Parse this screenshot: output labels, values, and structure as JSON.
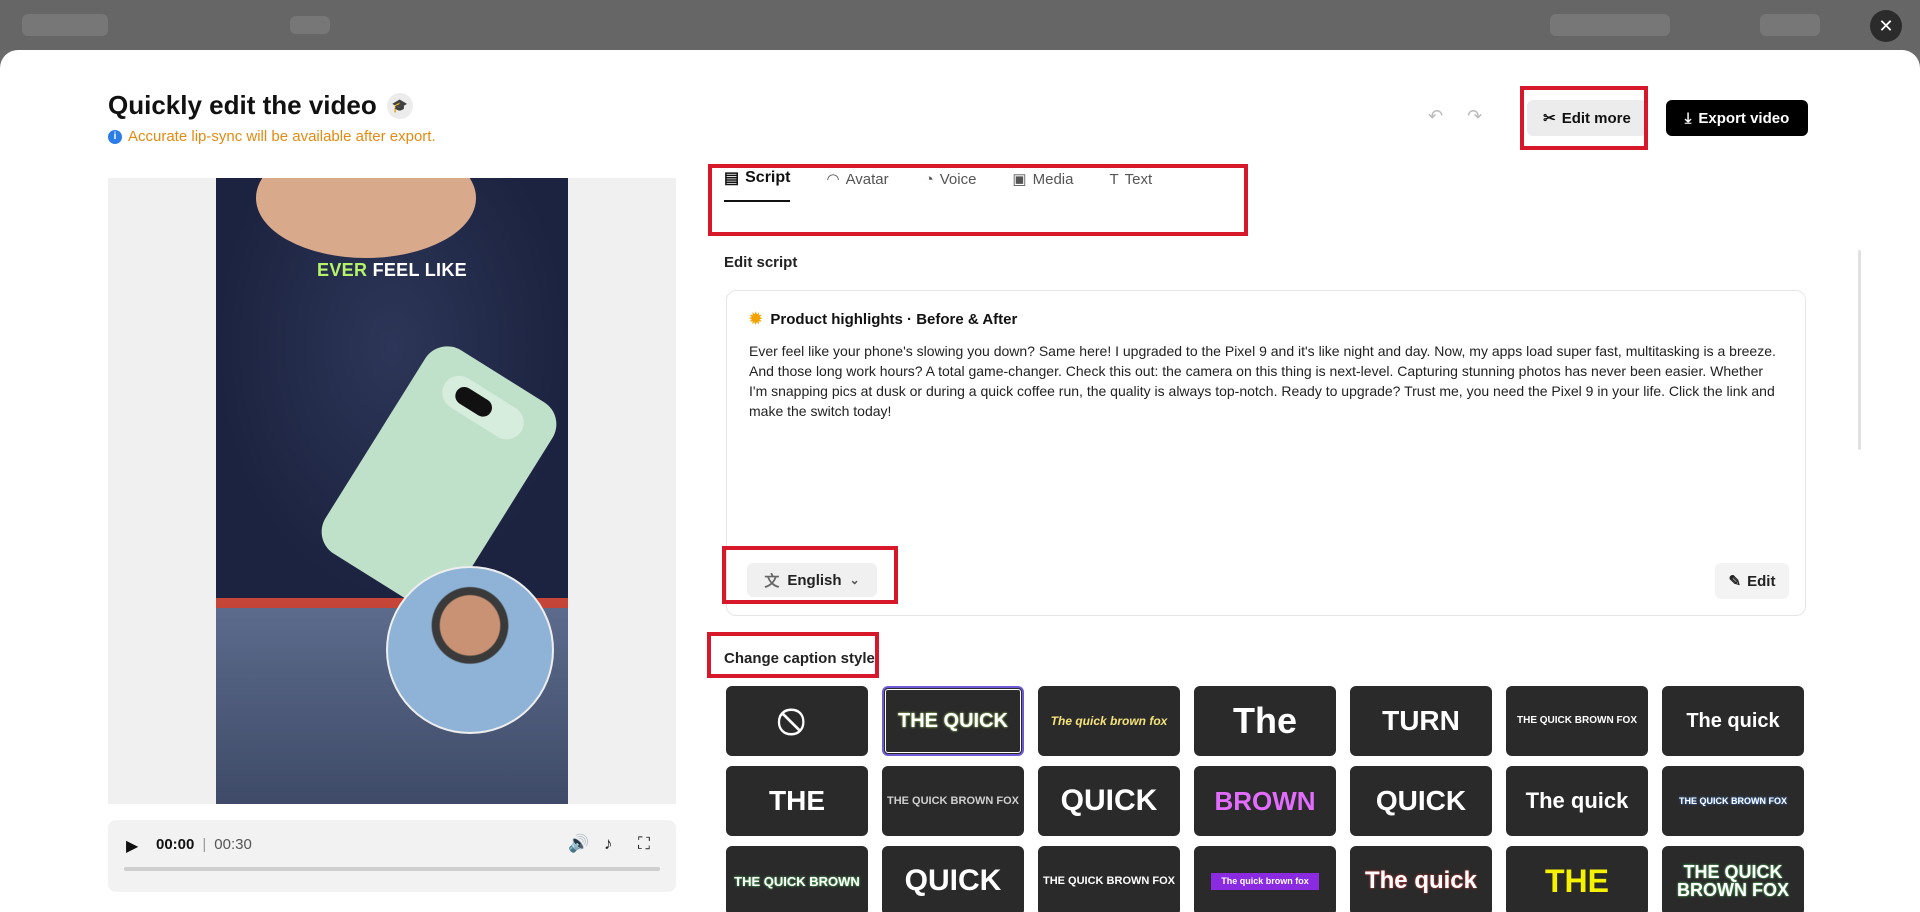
{
  "header": {
    "title": "Quickly edit the video",
    "notice": "Accurate lip-sync will be available after export.",
    "edit_more": "Edit more",
    "export": "Export video"
  },
  "preview": {
    "caption_highlight": "EVER",
    "caption_rest": "FEEL LIKE",
    "current_time": "00:00",
    "duration": "00:30",
    "progress": 0
  },
  "tabs": [
    {
      "label": "Script",
      "icon": "script-icon",
      "active": true
    },
    {
      "label": "Avatar",
      "icon": "avatar-icon",
      "active": false
    },
    {
      "label": "Voice",
      "icon": "voice-icon",
      "active": false
    },
    {
      "label": "Media",
      "icon": "media-icon",
      "active": false
    },
    {
      "label": "Text",
      "icon": "text-icon",
      "active": false
    }
  ],
  "script": {
    "section_label": "Edit script",
    "heading": "Product highlights · Before & After",
    "body": "Ever feel like your phone's slowing you down? Same here! I upgraded to the Pixel 9 and it's like night and day. Now, my apps load super fast, multitasking is a breeze. And those long work hours? A total game-changer. Check this out: the camera on this thing is next-level. Capturing stunning photos has never been easier. Whether I'm snapping pics at dusk or during a quick coffee run, the quality is always top-notch. Ready to upgrade? Trust me, you need the Pixel 9 in your life. Click the link and make the switch today!",
    "language": "English",
    "edit_label": "Edit"
  },
  "captions": {
    "section_label": "Change caption style",
    "styles": [
      {
        "text": "⃠",
        "color": "#ffffff"
      },
      {
        "text": "THE QUICK",
        "color": "#ffffff",
        "accent": "#b6f36a",
        "selected": true
      },
      {
        "text": "The quick brown fox",
        "color": "#f4e27a"
      },
      {
        "text": "The",
        "color": "#ffffff"
      },
      {
        "text": "TURN",
        "color": "#ffffff"
      },
      {
        "text": "THE QUICK BROWN FOX",
        "color": "#ffffff"
      },
      {
        "text": "The quick",
        "color": "#ffffff"
      },
      {
        "text": "THE",
        "color": "#ffffff"
      },
      {
        "text": "THE QUICK BROWN FOX",
        "color": "#cfcfcf"
      },
      {
        "text": "QUICK",
        "color": "#ffffff"
      },
      {
        "text": "BROWN",
        "color": "#e36cff"
      },
      {
        "text": "QUICK",
        "color": "#ffffff"
      },
      {
        "text": "The quick",
        "color": "#ffffff"
      },
      {
        "text": "THE QUICK BROWN FOX",
        "color": "#ffffff",
        "accent": "#3d8bff"
      },
      {
        "text": "THE QUICK BROWN",
        "color": "#ffffff",
        "accent": "#5de06a"
      },
      {
        "text": "QUICK",
        "color": "#ffffff"
      },
      {
        "text": "THE QUICK BROWN FOX",
        "color": "#ffffff"
      },
      {
        "text": "The quick brown fox",
        "color": "#ffffff",
        "accent": "#8a2be2"
      },
      {
        "text": "The quick",
        "color": "#ffffff",
        "accent": "#ff3b3b"
      },
      {
        "text": "THE",
        "color": "#f5f200"
      },
      {
        "text": "THE QUICK BROWN FOX",
        "color": "#ffffff",
        "accent": "#5de06a"
      }
    ]
  }
}
